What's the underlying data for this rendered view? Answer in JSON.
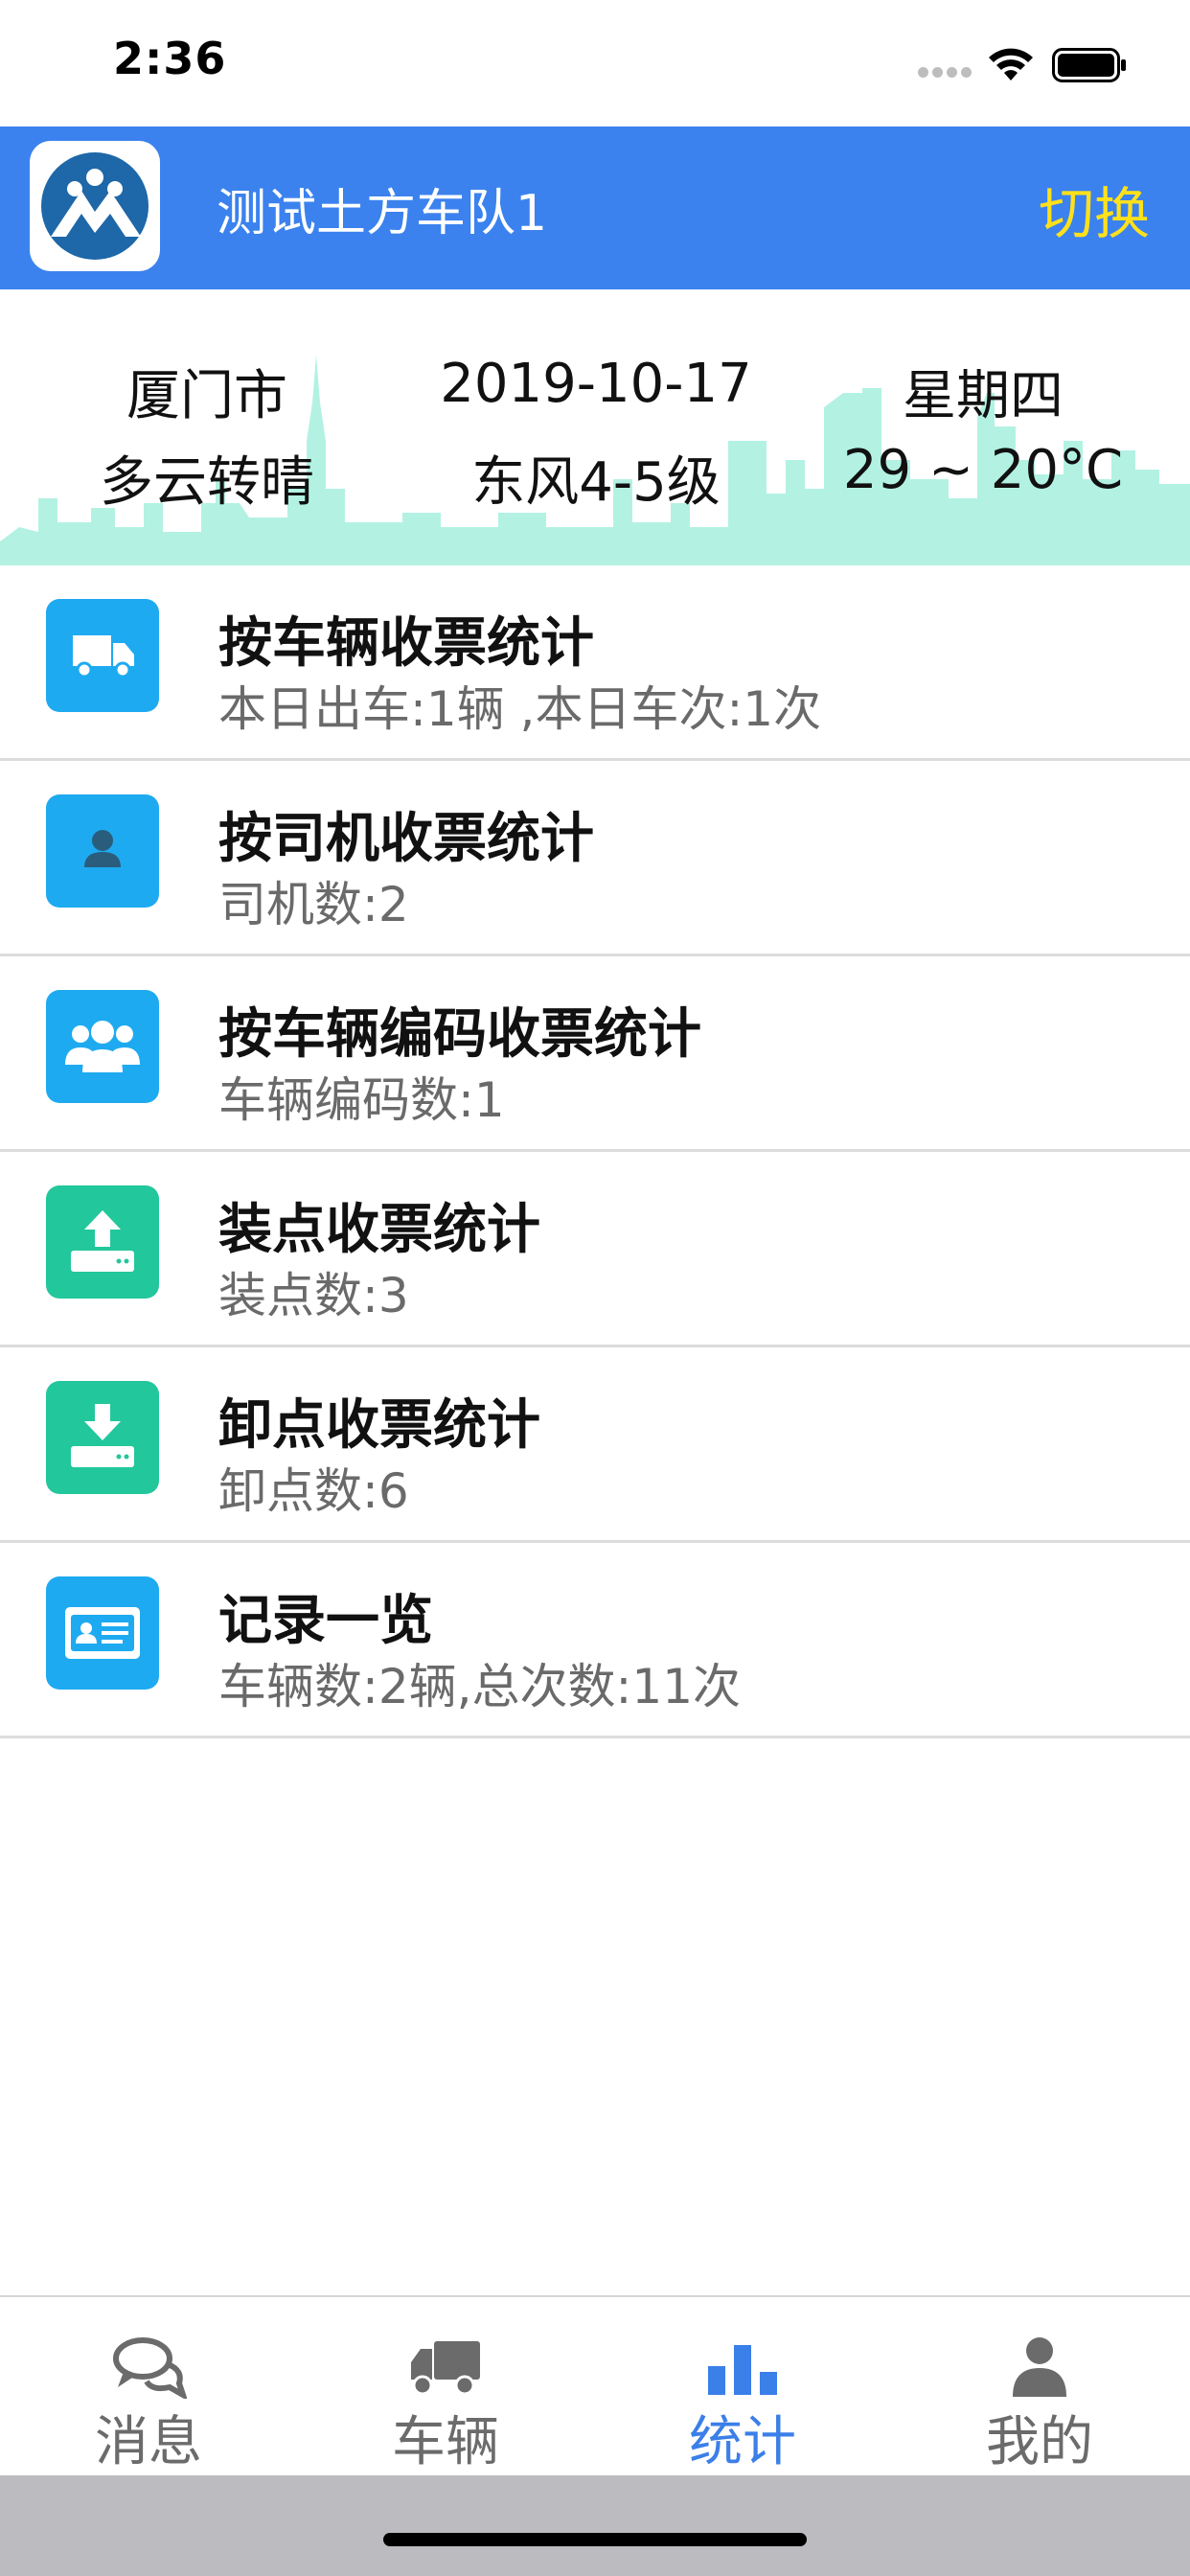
{
  "status_bar": {
    "time": "2:36"
  },
  "header": {
    "team_name": "测试土方车队1",
    "switch_label": "切换"
  },
  "weather": {
    "city": "厦门市",
    "date": "2019-10-17",
    "weekday": "星期四",
    "condition": "多云转晴",
    "wind": "东风4-5级",
    "temperature": "29 ~ 20°C"
  },
  "stats": [
    {
      "icon": "truck-icon",
      "title": "按车辆收票统计",
      "subtitle": "本日出车:1辆 ,本日车次:1次"
    },
    {
      "icon": "driver-icon",
      "title": "按司机收票统计",
      "subtitle": "司机数:2"
    },
    {
      "icon": "group-icon",
      "title": "按车辆编码收票统计",
      "subtitle": "车辆编码数:1"
    },
    {
      "icon": "upload-icon",
      "title": "装点收票统计",
      "subtitle": "装点数:3"
    },
    {
      "icon": "download-icon",
      "title": "卸点收票统计",
      "subtitle": "卸点数:6"
    },
    {
      "icon": "id-card-icon",
      "title": "记录一览",
      "subtitle": "车辆数:2辆,总次数:11次"
    }
  ],
  "tabs": [
    {
      "icon": "chat-icon",
      "label": "消息",
      "active": false
    },
    {
      "icon": "truck-icon",
      "label": "车辆",
      "active": false
    },
    {
      "icon": "bar-chart-icon",
      "label": "统计",
      "active": true
    },
    {
      "icon": "person-icon",
      "label": "我的",
      "active": false
    }
  ],
  "colors": {
    "header_bg": "#3b82ee",
    "switch_text": "#ffe01b",
    "blue_icon_bg": "#1eaaf1",
    "green_icon_bg": "#22c79c",
    "active_tab": "#3b7fe8",
    "skyline": "#b3f2e3"
  }
}
